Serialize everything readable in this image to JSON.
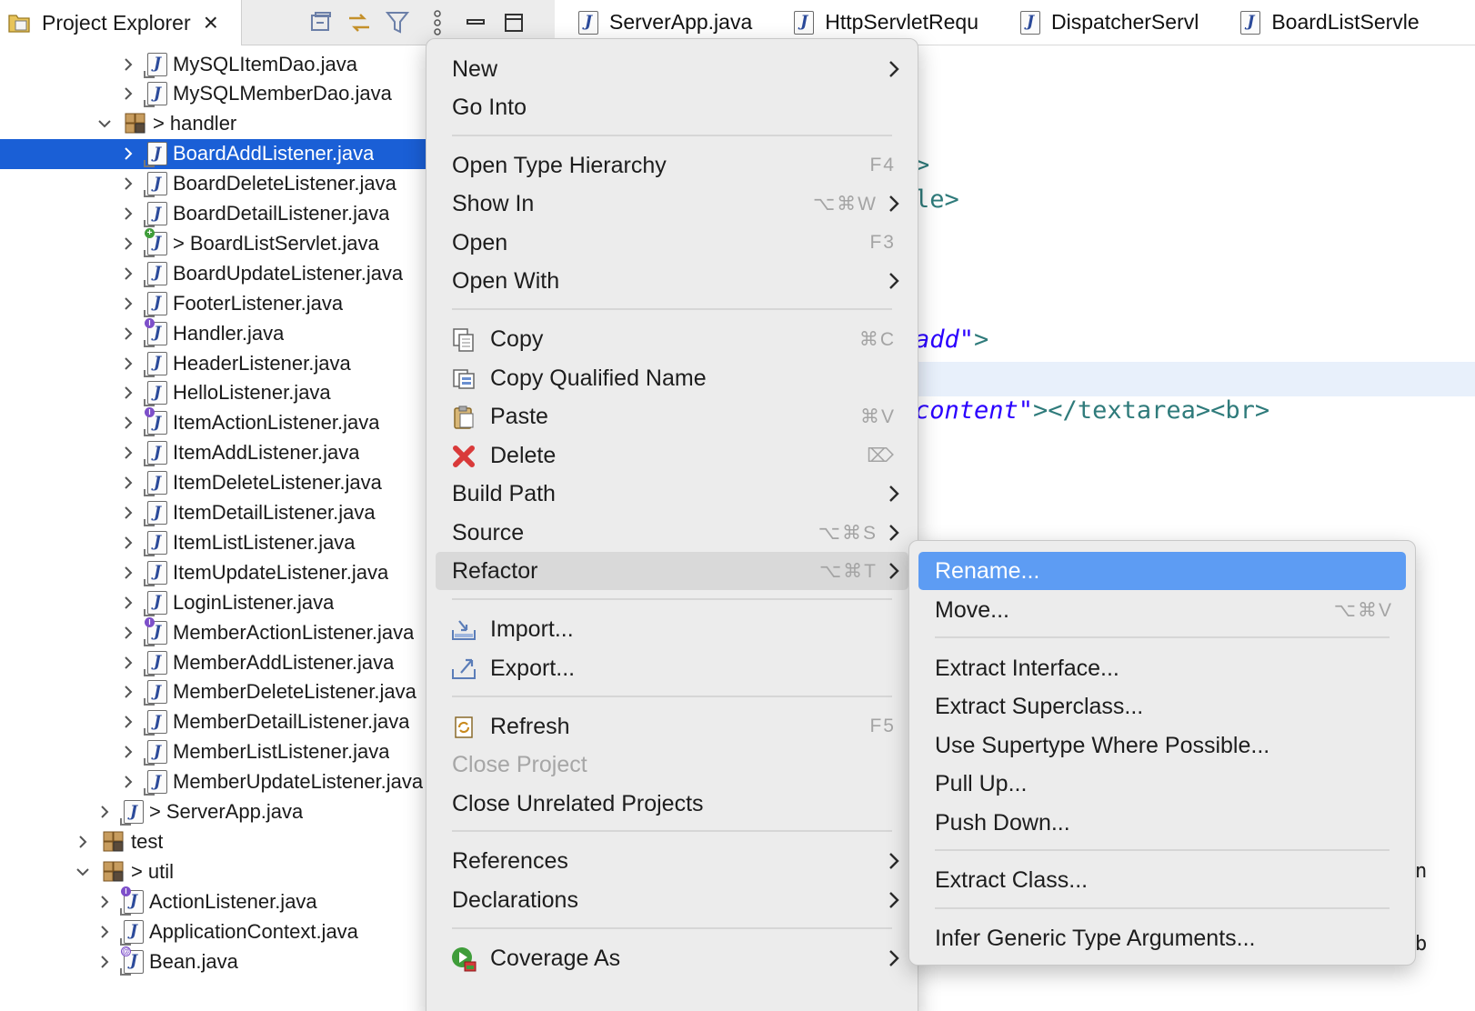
{
  "explorer": {
    "tab_title": "Project Explorer",
    "tab_icon": "project-explorer-icon",
    "toolbar_icons": [
      "collapse-all-icon",
      "link-with-editor-icon",
      "filter-icon",
      "view-menu-icon",
      "minimize-icon",
      "maximize-icon"
    ]
  },
  "editor_tabs": [
    {
      "label": "ServerApp.java"
    },
    {
      "label": "HttpServletRequ"
    },
    {
      "label": "DispatcherServl"
    },
    {
      "label": "BoardListServle"
    }
  ],
  "tree": [
    {
      "label": "MySQLItemDao.java",
      "icon": "java-class",
      "expanded": false
    },
    {
      "label": "MySQLMemberDao.java",
      "icon": "java-class",
      "expanded": false
    },
    {
      "label": "handler",
      "icon": "package",
      "dirty": ">",
      "expanded": true
    },
    {
      "label": "BoardAddListener.java",
      "icon": "java-class",
      "expanded": false,
      "selected": true
    },
    {
      "label": "BoardDeleteListener.java",
      "icon": "java-class",
      "expanded": false
    },
    {
      "label": "BoardDetailListener.java",
      "icon": "java-class",
      "expanded": false
    },
    {
      "label": "BoardListServlet.java",
      "icon": "java-class-new",
      "dirty": ">",
      "expanded": false
    },
    {
      "label": "BoardUpdateListener.java",
      "icon": "java-class",
      "expanded": false
    },
    {
      "label": "FooterListener.java",
      "icon": "java-class",
      "expanded": false
    },
    {
      "label": "Handler.java",
      "icon": "java-interface",
      "expanded": false
    },
    {
      "label": "HeaderListener.java",
      "icon": "java-class",
      "expanded": false
    },
    {
      "label": "HelloListener.java",
      "icon": "java-class",
      "expanded": false
    },
    {
      "label": "ItemActionListener.java",
      "icon": "java-interface",
      "expanded": false
    },
    {
      "label": "ItemAddListener.java",
      "icon": "java-class",
      "expanded": false
    },
    {
      "label": "ItemDeleteListener.java",
      "icon": "java-class",
      "expanded": false
    },
    {
      "label": "ItemDetailListener.java",
      "icon": "java-class",
      "expanded": false
    },
    {
      "label": "ItemListListener.java",
      "icon": "java-class",
      "expanded": false
    },
    {
      "label": "ItemUpdateListener.java",
      "icon": "java-class",
      "expanded": false
    },
    {
      "label": "LoginListener.java",
      "icon": "java-class",
      "expanded": false
    },
    {
      "label": "MemberActionListener.java",
      "icon": "java-interface",
      "expanded": false
    },
    {
      "label": "MemberAddListener.java",
      "icon": "java-class",
      "expanded": false
    },
    {
      "label": "MemberDeleteListener.java",
      "icon": "java-class",
      "expanded": false
    },
    {
      "label": "MemberDetailListener.java",
      "icon": "java-class",
      "expanded": false
    },
    {
      "label": "MemberListListener.java",
      "icon": "java-class",
      "expanded": false
    },
    {
      "label": "MemberUpdateListener.java",
      "icon": "java-class",
      "expanded": false
    },
    {
      "label": "ServerApp.java",
      "icon": "java-class",
      "dirty": ">",
      "expanded": false
    },
    {
      "label": "test",
      "icon": "package",
      "expanded": false
    },
    {
      "label": "util",
      "icon": "package",
      "dirty": ">",
      "expanded": true
    },
    {
      "label": "ActionListener.java",
      "icon": "java-interface",
      "expanded": false
    },
    {
      "label": "ApplicationContext.java",
      "icon": "java-class",
      "expanded": false
    },
    {
      "label": "Bean.java",
      "icon": "java-annotation",
      "expanded": false
    }
  ],
  "editor_code": {
    "frag1": ">",
    "frag2": "le>",
    "frag3_str": "add\"",
    "frag3_tail": ">",
    "frag4_str": "content\"",
    "frag4_tail": "></textarea><br>",
    "edge_n": "n",
    "edge_b": "b"
  },
  "context_menu": {
    "items": [
      {
        "label": "New",
        "submenu": true
      },
      {
        "label": "Go Into"
      },
      {
        "label": "Open Type Hierarchy",
        "shortcut": "F4"
      },
      {
        "label": "Show In",
        "shortcut": "⌥⌘W",
        "submenu": true
      },
      {
        "label": "Open",
        "shortcut": "F3"
      },
      {
        "label": "Open With",
        "submenu": true
      },
      {
        "label": "Copy",
        "shortcut": "⌘C",
        "icon": "copy-icon"
      },
      {
        "label": "Copy Qualified Name",
        "icon": "copy-qualified-name-icon"
      },
      {
        "label": "Paste",
        "shortcut": "⌘V",
        "icon": "paste-icon"
      },
      {
        "label": "Delete",
        "shortcut": "⌦",
        "icon": "delete-icon"
      },
      {
        "label": "Build Path",
        "submenu": true
      },
      {
        "label": "Source",
        "shortcut": "⌥⌘S",
        "submenu": true
      },
      {
        "label": "Refactor",
        "shortcut": "⌥⌘T",
        "submenu": true,
        "highlighted": true
      },
      {
        "label": "Import...",
        "icon": "import-icon"
      },
      {
        "label": "Export...",
        "icon": "export-icon"
      },
      {
        "label": "Refresh",
        "shortcut": "F5",
        "icon": "refresh-icon"
      },
      {
        "label": "Close Project",
        "disabled": true
      },
      {
        "label": "Close Unrelated Projects"
      },
      {
        "label": "References",
        "submenu": true
      },
      {
        "label": "Declarations",
        "submenu": true
      },
      {
        "label": "Coverage As",
        "submenu": true,
        "icon": "coverage-icon"
      }
    ]
  },
  "refactor_menu": {
    "items": [
      {
        "label": "Rename...",
        "active": true
      },
      {
        "label": "Move...",
        "shortcut": "⌥⌘V"
      },
      {
        "label": "Extract Interface..."
      },
      {
        "label": "Extract Superclass..."
      },
      {
        "label": "Use Supertype Where Possible..."
      },
      {
        "label": "Pull Up..."
      },
      {
        "label": "Push Down..."
      },
      {
        "label": "Extract Class..."
      },
      {
        "label": "Infer Generic Type Arguments..."
      }
    ]
  },
  "colors": {
    "selection": "#1a5fd6",
    "menu_active": "#5d9cf3",
    "menu_bg": "#ececec"
  }
}
